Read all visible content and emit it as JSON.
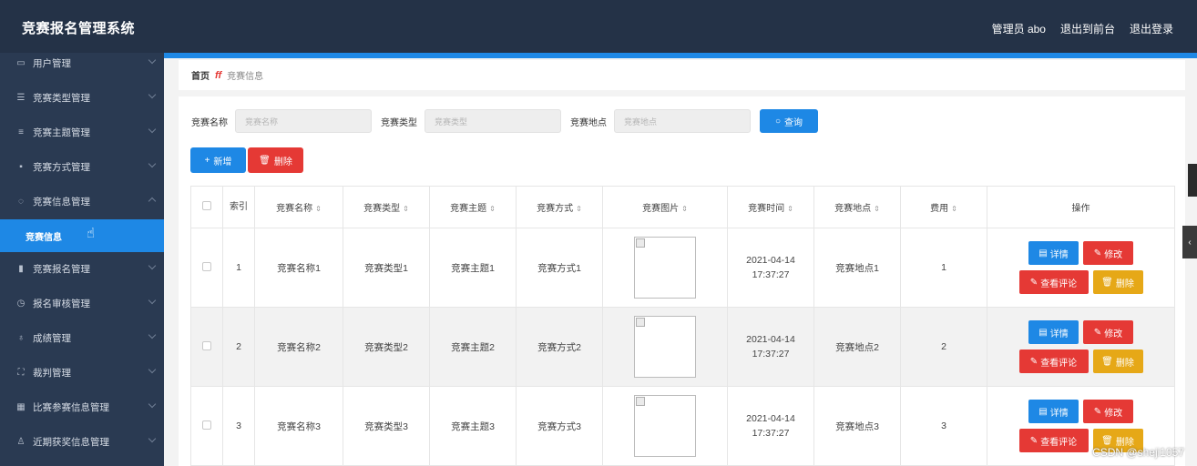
{
  "header": {
    "title": "竞赛报名管理系统",
    "admin": "管理员 abo",
    "to_front": "退出到前台",
    "logout": "退出登录"
  },
  "sidebar": {
    "items": [
      {
        "label": "用户管理",
        "icon": "user-icon"
      },
      {
        "label": "竞赛类型管理",
        "icon": "sliders-icon"
      },
      {
        "label": "竞赛主题管理",
        "icon": "list-icon"
      },
      {
        "label": "竞赛方式管理",
        "icon": "clipboard-icon"
      },
      {
        "label": "竞赛信息管理",
        "icon": "compass-icon"
      },
      {
        "label": "竞赛报名管理",
        "icon": "bar-chart-icon"
      },
      {
        "label": "报名审核管理",
        "icon": "clock-icon"
      },
      {
        "label": "成绩管理",
        "icon": "mic-icon"
      },
      {
        "label": "裁判管理",
        "icon": "fullscreen-icon"
      },
      {
        "label": "比赛参赛信息管理",
        "icon": "grid-icon"
      },
      {
        "label": "近期获奖信息管理",
        "icon": "person-icon"
      }
    ],
    "active_sub": "竞赛信息"
  },
  "breadcrumb": {
    "home": "首页",
    "separator": "ff",
    "current": "竞赛信息"
  },
  "search": {
    "name_label": "竞赛名称",
    "name_placeholder": "竞赛名称",
    "type_label": "竞赛类型",
    "type_placeholder": "竞赛类型",
    "location_label": "竞赛地点",
    "location_placeholder": "竞赛地点",
    "query_button": "查询"
  },
  "toolbar": {
    "add": "新增",
    "delete": "删除"
  },
  "table": {
    "headers": {
      "index": "索引",
      "name": "竞赛名称",
      "type": "竞赛类型",
      "topic": "竞赛主题",
      "mode": "竞赛方式",
      "image": "竞赛图片",
      "time": "竞赛时间",
      "location": "竞赛地点",
      "fee": "费用",
      "actions": "操作"
    },
    "rows": [
      {
        "index": "1",
        "name": "竞赛名称1",
        "type": "竞赛类型1",
        "topic": "竞赛主题1",
        "mode": "竞赛方式1",
        "time": "2021-04-14 17:37:27",
        "location": "竞赛地点1",
        "fee": "1"
      },
      {
        "index": "2",
        "name": "竞赛名称2",
        "type": "竞赛类型2",
        "topic": "竞赛主题2",
        "mode": "竞赛方式2",
        "time": "2021-04-14 17:37:27",
        "location": "竞赛地点2",
        "fee": "2"
      },
      {
        "index": "3",
        "name": "竞赛名称3",
        "type": "竞赛类型3",
        "topic": "竞赛主题3",
        "mode": "竞赛方式3",
        "time": "2021-04-14 17:37:27",
        "location": "竞赛地点3",
        "fee": "3"
      }
    ],
    "action_labels": {
      "detail": "详情",
      "edit": "修改",
      "review": "查看评论",
      "remove": "删除"
    }
  },
  "watermark": "CSDN @sheji1057",
  "colors": {
    "header_bg": "#243247",
    "sidebar_bg": "#2a3a52",
    "primary": "#1e88e5",
    "danger": "#e53935",
    "warning": "#e6a817"
  }
}
